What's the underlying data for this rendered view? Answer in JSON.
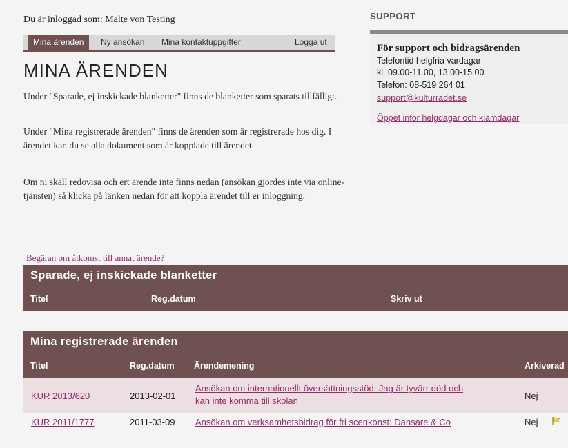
{
  "login_line": "Du är inloggad som: Malte von Testing",
  "nav": {
    "items": [
      "Mina ärenden",
      "Ny ansökan",
      "Mina kontaktuppgifter",
      "Logga ut"
    ],
    "active": "Mina ärenden"
  },
  "page_title": "MINA ÄRENDEN",
  "paragraphs": [
    "Under \"Sparade, ej inskickade blanketter\" finns de blanketter som sparats tillfälligt.",
    "Under \"Mina registrerade ärenden\" finns de ärenden som är registrerade hos dig. I ärendet kan du se alla dokument som är kopplade till ärendet.",
    "Om ni skall redovisa och ert ärende inte finns nedan (ansökan gjordes inte via online-tjänsten) så klicka på länken nedan för att koppla ärendet till er inloggning."
  ],
  "support": {
    "heading": "SUPPORT",
    "title": "För support och bidragsärenden",
    "lines": [
      "Telefontid helgfria vardagar",
      "kl. 09.00-11.00, 13.00-15.00",
      "Telefon: 08-519 264 01"
    ],
    "email": "support@kulturradet.se",
    "holiday_link": "Öppet inför helgdagar och klämdagar"
  },
  "access_link": "Begäran om åtkomst till annat ärende?",
  "saved_forms": {
    "title": "Sparade, ej inskickade blanketter",
    "columns": [
      "Titel",
      "Reg.datum",
      "Skriv ut"
    ]
  },
  "registered": {
    "title": "Mina registrerade ärenden",
    "columns": [
      "Titel",
      "Reg.datum",
      "Ärendemening",
      "Arkiverad"
    ],
    "rows": [
      {
        "title": "KUR 2013/620",
        "date": "2013-02-01",
        "subject_line1": "Ansökan om internationellt översättningsstöd: Jag är tyvärr död och",
        "subject_line2": "kan inte komma till skolan",
        "archived": "Nej"
      },
      {
        "title": "KUR 2011/1777",
        "date": "2011-03-09",
        "subject_line1": "Ansökan om verksamhetsbidrag för fri scenkonst: Dansare & Co",
        "subject_line2": "",
        "archived": "Nej"
      }
    ]
  },
  "colors": {
    "accent": "#6e5150",
    "link": "#9b2a6a",
    "background": "#f4f4f4"
  }
}
